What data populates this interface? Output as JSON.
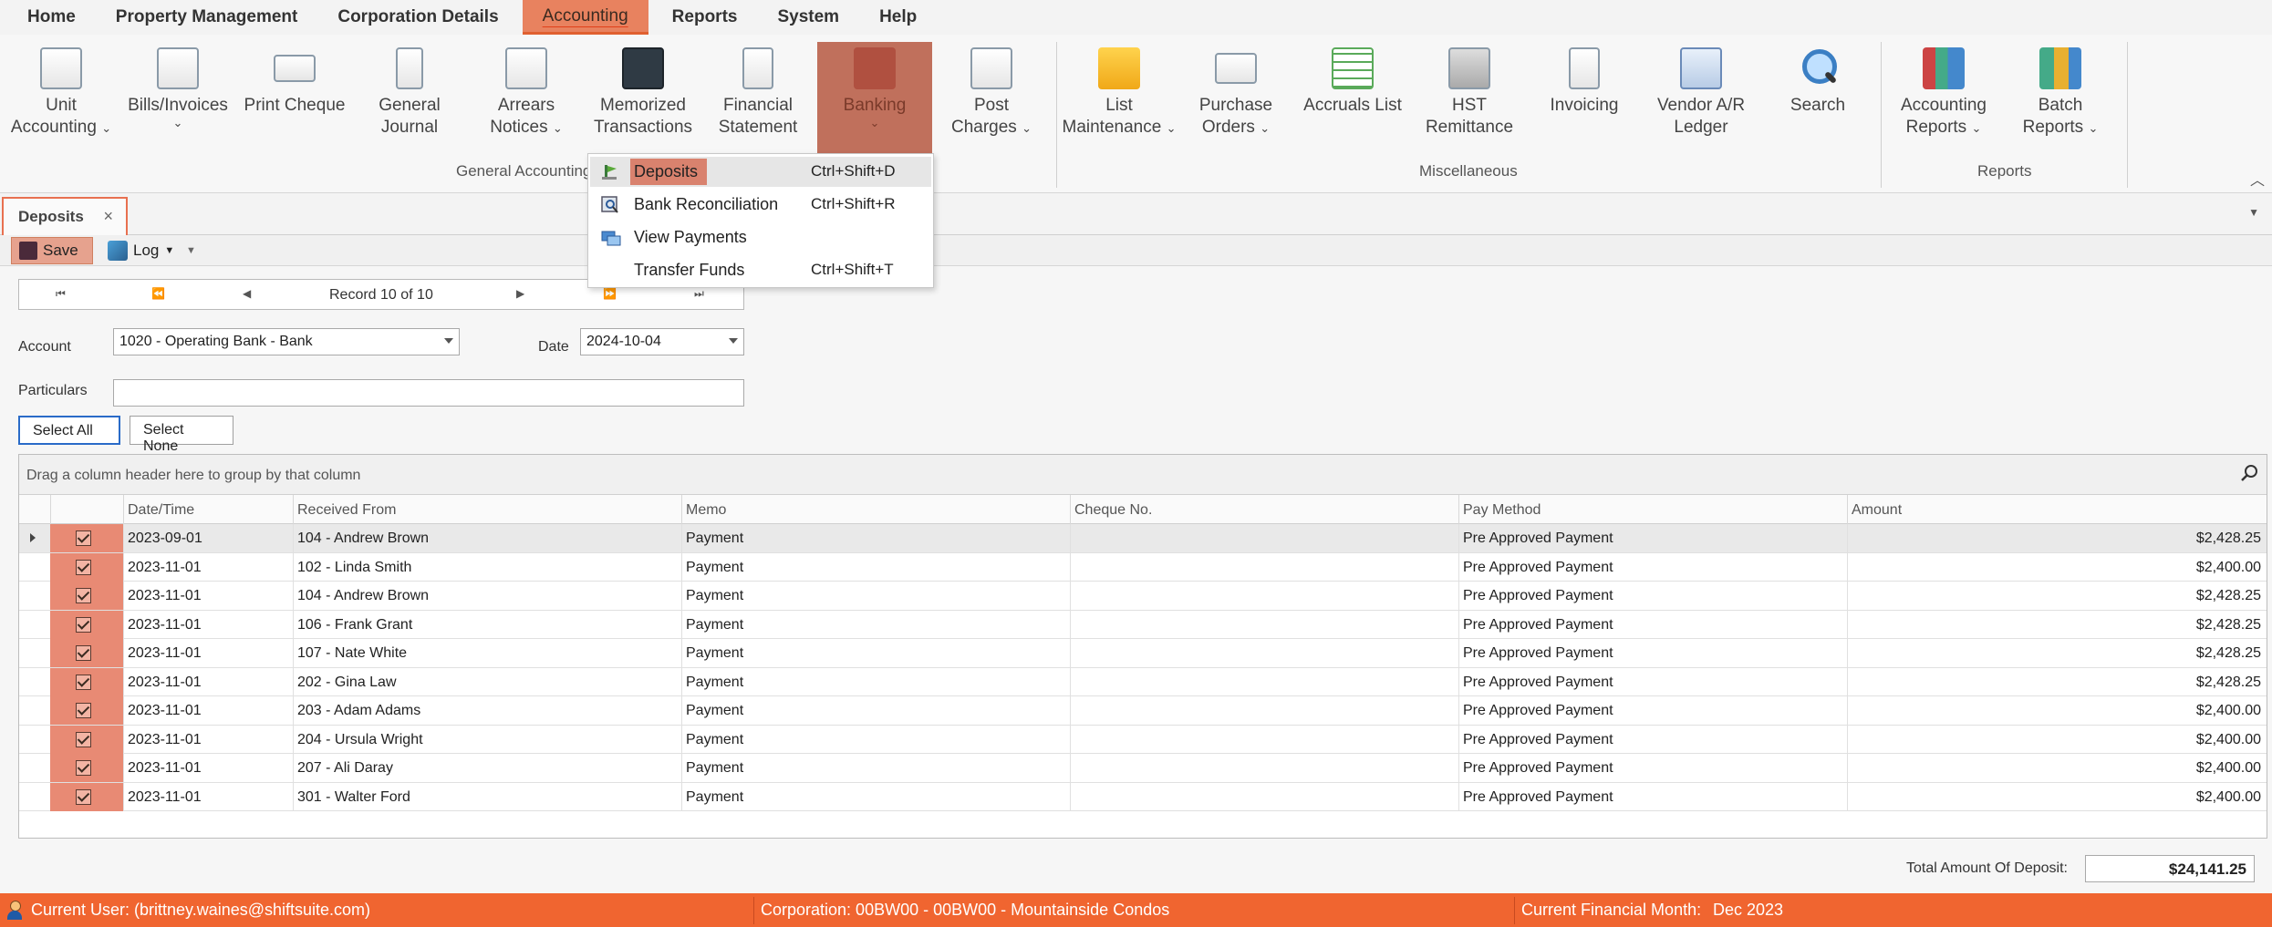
{
  "menu": [
    "Home",
    "Property Management",
    "Corporation Details",
    "Accounting",
    "Reports",
    "System",
    "Help"
  ],
  "ribbon": {
    "buttons": [
      {
        "l1": "Unit",
        "l2": "Accounting",
        "chev": "⌄"
      },
      {
        "l1": "Bills/Invoices",
        "l2": "",
        "chev": "⌄"
      },
      {
        "l1": "Print Cheque",
        "l2": "",
        "chev": ""
      },
      {
        "l1": "General",
        "l2": "Journal",
        "chev": ""
      },
      {
        "l1": "Arrears",
        "l2": "Notices",
        "chev": "⌄"
      },
      {
        "l1": "Memorized",
        "l2": "Transactions",
        "chev": ""
      },
      {
        "l1": "Financial",
        "l2": "Statement",
        "chev": ""
      },
      {
        "l1": "Banking",
        "l2": "",
        "chev": "⌄"
      },
      {
        "l1": "Post",
        "l2": "Charges",
        "chev": "⌄"
      },
      {
        "l1": "List",
        "l2": "Maintenance",
        "chev": "⌄"
      },
      {
        "l1": "Purchase",
        "l2": "Orders",
        "chev": "⌄"
      },
      {
        "l1": "Accruals List",
        "l2": "",
        "chev": ""
      },
      {
        "l1": "HST",
        "l2": "Remittance",
        "chev": ""
      },
      {
        "l1": "Invoicing",
        "l2": "",
        "chev": ""
      },
      {
        "l1": "Vendor A/R",
        "l2": "Ledger",
        "chev": ""
      },
      {
        "l1": "Search",
        "l2": "",
        "chev": ""
      },
      {
        "l1": "Accounting",
        "l2": "Reports",
        "chev": "⌄"
      },
      {
        "l1": "Batch",
        "l2": "Reports",
        "chev": "⌄"
      }
    ],
    "groups": [
      "General Accounting",
      "Miscellaneous",
      "Reports"
    ]
  },
  "tab": {
    "title": "Deposits",
    "close": "×"
  },
  "toolbar": {
    "save": "Save",
    "log": "Log"
  },
  "navigator": {
    "record": "Record 10 of 10"
  },
  "form": {
    "account_label": "Account",
    "account_value": "1020 - Operating Bank - Bank",
    "date_label": "Date",
    "date_value": "2024-10-04",
    "particulars_label": "Particulars",
    "particulars_value": "",
    "select_all": "Select All",
    "select_none": "Select None"
  },
  "grid": {
    "group_hint": "Drag a column header here to group by that column",
    "columns": [
      "Date/Time",
      "Received From",
      "Memo",
      "Cheque No.",
      "Pay Method",
      "Amount"
    ],
    "rows": [
      {
        "date": "2023-09-01",
        "from": "104 - Andrew Brown",
        "memo": "Payment",
        "cheque": "",
        "method": "Pre Approved Payment",
        "amount": "$2,428.25"
      },
      {
        "date": "2023-11-01",
        "from": "102 - Linda Smith",
        "memo": "Payment",
        "cheque": "",
        "method": "Pre Approved Payment",
        "amount": "$2,400.00"
      },
      {
        "date": "2023-11-01",
        "from": "104 - Andrew Brown",
        "memo": "Payment",
        "cheque": "",
        "method": "Pre Approved Payment",
        "amount": "$2,428.25"
      },
      {
        "date": "2023-11-01",
        "from": "106 - Frank Grant",
        "memo": "Payment",
        "cheque": "",
        "method": "Pre Approved Payment",
        "amount": "$2,428.25"
      },
      {
        "date": "2023-11-01",
        "from": "107 - Nate White",
        "memo": "Payment",
        "cheque": "",
        "method": "Pre Approved Payment",
        "amount": "$2,428.25"
      },
      {
        "date": "2023-11-01",
        "from": "202 - Gina Law",
        "memo": "Payment",
        "cheque": "",
        "method": "Pre Approved Payment",
        "amount": "$2,428.25"
      },
      {
        "date": "2023-11-01",
        "from": "203 - Adam Adams",
        "memo": "Payment",
        "cheque": "",
        "method": "Pre Approved Payment",
        "amount": "$2,400.00"
      },
      {
        "date": "2023-11-01",
        "from": "204 - Ursula Wright",
        "memo": "Payment",
        "cheque": "",
        "method": "Pre Approved Payment",
        "amount": "$2,400.00"
      },
      {
        "date": "2023-11-01",
        "from": "207 - Ali Daray",
        "memo": "Payment",
        "cheque": "",
        "method": "Pre Approved Payment",
        "amount": "$2,400.00"
      },
      {
        "date": "2023-11-01",
        "from": "301 - Walter Ford",
        "memo": "Payment",
        "cheque": "",
        "method": "Pre Approved Payment",
        "amount": "$2,400.00"
      }
    ]
  },
  "total": {
    "label": "Total Amount Of Deposit:",
    "value": "$24,141.25"
  },
  "status": {
    "user": "Current User: (brittney.waines@shiftsuite.com)",
    "corporation": "Corporation: 00BW00 - 00BW00 - Mountainside Condos",
    "month_label": "Current Financial Month:",
    "month_value": "Dec 2023"
  },
  "banking_menu": [
    {
      "label": "Deposits",
      "shortcut": "Ctrl+Shift+D"
    },
    {
      "label": "Bank Reconciliation",
      "shortcut": "Ctrl+Shift+R"
    },
    {
      "label": "View Payments",
      "shortcut": ""
    },
    {
      "label": "Transfer Funds",
      "shortcut": "Ctrl+Shift+T"
    }
  ]
}
